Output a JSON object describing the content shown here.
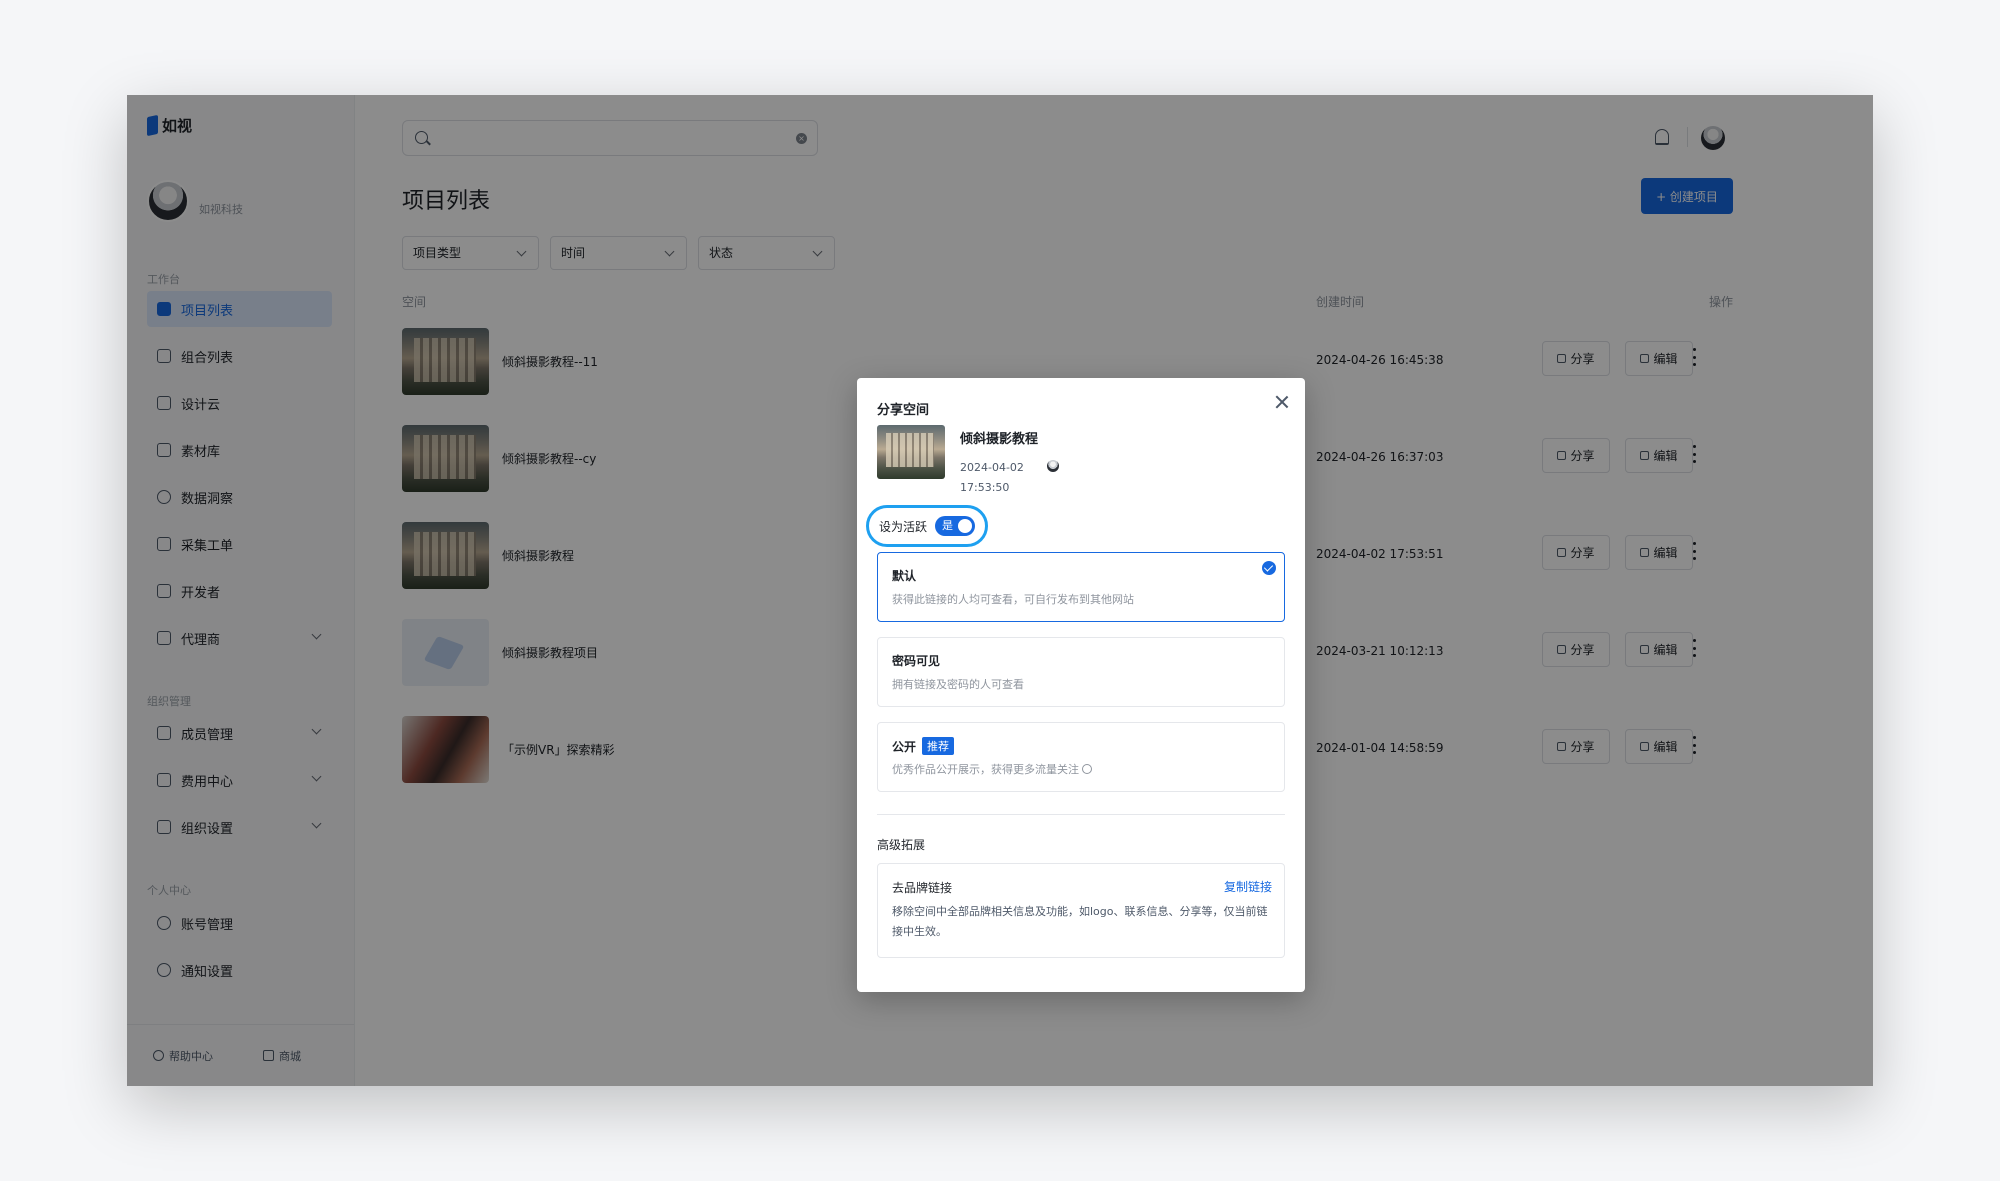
{
  "app": {
    "logo": "如视"
  },
  "profile": {
    "name": "如视科技"
  },
  "sidebar": {
    "sections": [
      "工作台",
      "组织管理",
      "个人中心"
    ],
    "items": [
      {
        "label": "项目列表",
        "active": true
      },
      {
        "label": "组合列表"
      },
      {
        "label": "设计云"
      },
      {
        "label": "素材库"
      },
      {
        "label": "数据洞察"
      },
      {
        "label": "采集工单"
      },
      {
        "label": "开发者"
      },
      {
        "label": "代理商",
        "expandable": true
      },
      {
        "label": "成员管理",
        "expandable": true
      },
      {
        "label": "费用中心",
        "expandable": true
      },
      {
        "label": "组织设置",
        "expandable": true
      },
      {
        "label": "账号管理"
      },
      {
        "label": "通知设置"
      }
    ],
    "footer": {
      "help": "帮助中心",
      "mall": "商城"
    }
  },
  "header": {
    "search_placeholder": ""
  },
  "main": {
    "title": "项目列表",
    "create_label": "+ 创建项目",
    "filters": [
      "项目类型",
      "时间",
      "状态"
    ],
    "columns": {
      "space": "空间",
      "created": "创建时间",
      "action": "操作"
    },
    "rows": [
      {
        "name": "倾斜摄影教程--11",
        "time": "2024-04-26 16:45:38",
        "thumb": "city"
      },
      {
        "name": "倾斜摄影教程--cy",
        "time": "2024-04-26 16:37:03",
        "thumb": "city"
      },
      {
        "name": "倾斜摄影教程",
        "time": "2024-04-02 17:53:51",
        "thumb": "city"
      },
      {
        "name": "倾斜摄影教程项目",
        "time": "2024-03-21 10:12:13",
        "thumb": "box"
      },
      {
        "name": "「示例VR」探索精彩",
        "time": "2024-01-04 14:58:59",
        "thumb": "vr"
      }
    ],
    "row_actions": {
      "share": "分享",
      "edit": "编辑"
    }
  },
  "modal": {
    "title": "分享空间",
    "project_name": "倾斜摄影教程",
    "date": "2024-04-02",
    "time": "17:53:50",
    "active_label": "设为活跃",
    "toggle_text": "是",
    "options": [
      {
        "title": "默认",
        "desc": "获得此链接的人均可查看，可自行发布到其他网站",
        "selected": true
      },
      {
        "title": "密码可见",
        "desc": "拥有链接及密码的人可查看"
      },
      {
        "title": "公开",
        "badge": "推荐",
        "desc": "优秀作品公开展示，获得更多流量关注"
      }
    ],
    "advanced_title": "高级拓展",
    "brand": {
      "title": "去品牌链接",
      "copy": "复制链接",
      "desc": "移除空间中全部品牌相关信息及功能，如logo、联系信息、分享等，仅当前链接中生效。"
    },
    "accent_color": "#1769e0",
    "highlight_color": "#1ea0f0"
  }
}
